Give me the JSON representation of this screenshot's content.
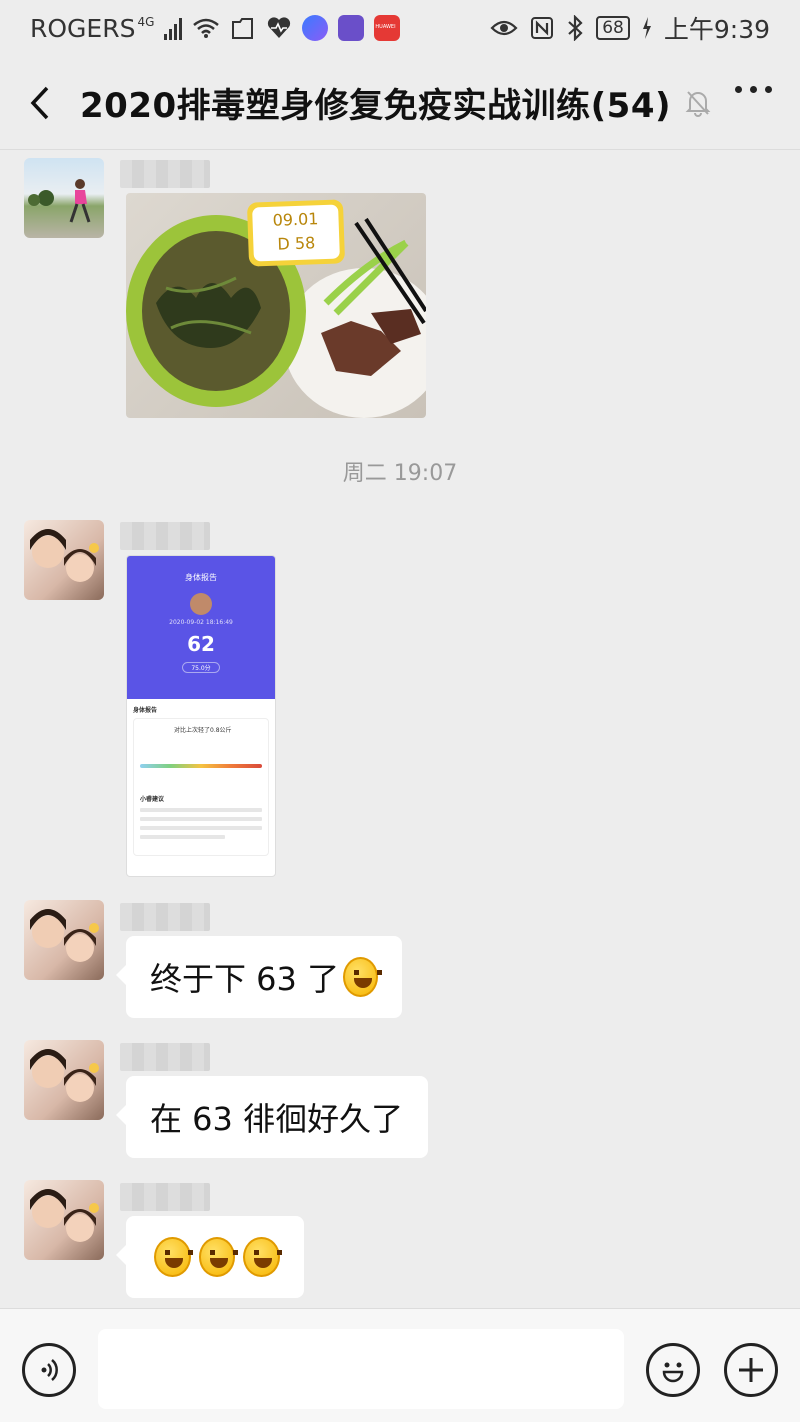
{
  "status_bar": {
    "carrier": "ROGERS",
    "network": "4G",
    "battery": "68",
    "time": "上午9:39",
    "app_icons": [
      "files-icon",
      "health-icon",
      "music-icon",
      "huawei-music-icon",
      "huawei-app-icon"
    ],
    "huawei_label": "HUAWEI"
  },
  "header": {
    "title": "2020排毒塑身修复免疫实战训练(54)",
    "back_icon": "back-arrow-icon",
    "mute_icon": "muted-bell-icon",
    "more_icon": "more-dots-icon"
  },
  "messages": [
    {
      "type": "image",
      "avatar": "runner-avatar",
      "image": "food-photo",
      "tag_line1": "09.01",
      "tag_line2": "D 58"
    },
    {
      "type": "time",
      "text": "周二 19:07"
    },
    {
      "type": "image",
      "avatar": "selfie-avatar",
      "image": "body-report-screenshot",
      "shot": {
        "title": "身体报告",
        "meta": "2020-09-02 18:16:49",
        "score": "62",
        "pill": "75.0分",
        "section": "身体报告",
        "note": "对比上次轻了0.8公斤",
        "tip": "小睿建议"
      }
    },
    {
      "type": "text",
      "avatar": "selfie-avatar",
      "text": "终于下 63 了",
      "emoji": "laugh-cry-emoji"
    },
    {
      "type": "text",
      "avatar": "selfie-avatar",
      "text": "在 63 徘徊好久了"
    },
    {
      "type": "text",
      "avatar": "selfie-avatar",
      "text": "",
      "emoji_count": 3,
      "emoji": "grin-emoji"
    }
  ],
  "input_bar": {
    "voice_icon": "voice-icon",
    "emoji_icon": "emoji-icon",
    "plus_icon": "plus-icon"
  },
  "colors": {
    "background": "#ededed",
    "bubble": "#ffffff",
    "report_purple": "#5a54e6"
  }
}
